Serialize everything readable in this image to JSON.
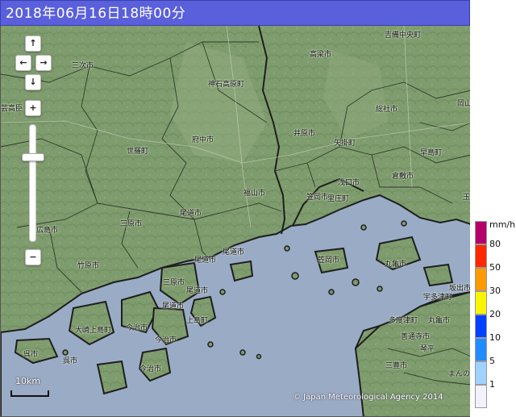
{
  "title": "2018年06月16日18時00分",
  "controls": {
    "pan_up": "↑",
    "pan_left": "←",
    "pan_right": "→",
    "pan_down": "↓",
    "zoom_in": "+",
    "zoom_out": "−"
  },
  "scale": {
    "label": "10km"
  },
  "copyright": "© Japan Meteorological Agency 2014",
  "legend": {
    "unit": "mm/h",
    "levels": [
      {
        "label": "80",
        "color": "#b4006a"
      },
      {
        "label": "50",
        "color": "#ff2800"
      },
      {
        "label": "30",
        "color": "#ff9900"
      },
      {
        "label": "20",
        "color": "#faf500"
      },
      {
        "label": "10",
        "color": "#0041ff"
      },
      {
        "label": "5",
        "color": "#218cff"
      },
      {
        "label": "1",
        "color": "#a0d2ff"
      },
      {
        "label": "",
        "color": "#f2f2ff"
      }
    ]
  },
  "colors": {
    "land": "#7f9c6e",
    "sea": "#9aabc6",
    "title_bg": "#5a5fdc"
  },
  "places": [
    {
      "id": "kibichuo",
      "label": "吉備中央町"
    },
    {
      "id": "takahashi",
      "label": "高梁市"
    },
    {
      "id": "miyoshi",
      "label": "三次市"
    },
    {
      "id": "jinsekikogen",
      "label": "神石高原町"
    },
    {
      "id": "soja",
      "label": "総社市"
    },
    {
      "id": "okayama",
      "label": "岡山"
    },
    {
      "id": "geihoku",
      "label": "芸高臣"
    },
    {
      "id": "ibara",
      "label": "井原市"
    },
    {
      "id": "yakage",
      "label": "矢掛町"
    },
    {
      "id": "fuchu",
      "label": "府中市"
    },
    {
      "id": "sera",
      "label": "世羅町"
    },
    {
      "id": "hayashima",
      "label": "早島町"
    },
    {
      "id": "kurashiki",
      "label": "倉敷市"
    },
    {
      "id": "asakuchi",
      "label": "浅口市"
    },
    {
      "id": "fukuyama",
      "label": "福山市"
    },
    {
      "id": "kasaoka",
      "label": "笠岡市"
    },
    {
      "id": "satosho",
      "label": "里庄町"
    },
    {
      "id": "tama",
      "label": "玉"
    },
    {
      "id": "onomichi1",
      "label": "尾道市"
    },
    {
      "id": "mihara",
      "label": "三原市"
    },
    {
      "id": "hiroshima",
      "label": "広島市"
    },
    {
      "id": "takehara",
      "label": "竹原市"
    },
    {
      "id": "onomichi2",
      "label": "尾道市"
    },
    {
      "id": "onomichi3",
      "label": "尾道市"
    },
    {
      "id": "kasaoka2",
      "label": "笠岡市"
    },
    {
      "id": "marugame",
      "label": "丸亀市"
    },
    {
      "id": "sakaide",
      "label": "坂出市"
    },
    {
      "id": "utazu",
      "label": "宇多津町"
    },
    {
      "id": "mihara2",
      "label": "三原市"
    },
    {
      "id": "onomichi4",
      "label": "尾道市"
    },
    {
      "id": "onomichi5",
      "label": "尾道市"
    },
    {
      "id": "kamijima",
      "label": "上島町"
    },
    {
      "id": "osakikamijima",
      "label": "大崎上島町"
    },
    {
      "id": "imabari1",
      "label": "今治市"
    },
    {
      "id": "imabari2",
      "label": "今治市"
    },
    {
      "id": "tadotsu",
      "label": "多度津町"
    },
    {
      "id": "marugame2",
      "label": "丸亀市"
    },
    {
      "id": "zentsuji",
      "label": "善通寺市"
    },
    {
      "id": "kotohira",
      "label": "琴平"
    },
    {
      "id": "kure",
      "label": "呉市"
    },
    {
      "id": "kure2",
      "label": "呉市"
    },
    {
      "id": "mitoyo",
      "label": "三豊市"
    },
    {
      "id": "imabari3",
      "label": "今治市"
    },
    {
      "id": "manno",
      "label": "まんの"
    }
  ]
}
